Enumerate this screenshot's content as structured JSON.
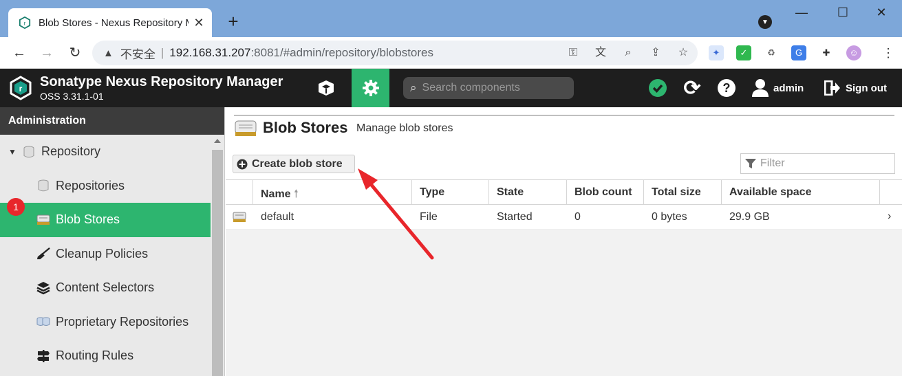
{
  "browser": {
    "tab_title": "Blob Stores - Nexus Repository Manager",
    "new_tab": "+",
    "win_min": "—",
    "win_max": "☐",
    "win_close": "✕",
    "tab_close": "✕",
    "insecure": "不安全",
    "url_host": "192.168.31.207",
    "url_rest": ":8081/#admin/repository/blobstores"
  },
  "app": {
    "title": "Sonatype Nexus Repository Manager",
    "version": "OSS 3.31.1-01",
    "search_placeholder": "Search components",
    "user": "admin",
    "signout": "Sign out"
  },
  "sidebar": {
    "header": "Administration",
    "badge": "1",
    "items": [
      {
        "label": "Repository"
      },
      {
        "label": "Repositories"
      },
      {
        "label": "Blob Stores"
      },
      {
        "label": "Cleanup Policies"
      },
      {
        "label": "Content Selectors"
      },
      {
        "label": "Proprietary Repositories"
      },
      {
        "label": "Routing Rules"
      }
    ]
  },
  "main": {
    "title": "Blob Stores",
    "subtitle": "Manage blob stores",
    "create_button": "Create blob store",
    "filter_placeholder": "Filter",
    "columns": [
      "Name",
      "Type",
      "State",
      "Blob count",
      "Total size",
      "Available space"
    ],
    "rows": [
      {
        "name": "default",
        "type": "File",
        "state": "Started",
        "blob_count": "0",
        "total_size": "0 bytes",
        "available": "29.9 GB"
      }
    ]
  },
  "colors": {
    "accent": "#2db56f",
    "header_bg": "#1e1e1e",
    "annotation": "#e8262b"
  }
}
